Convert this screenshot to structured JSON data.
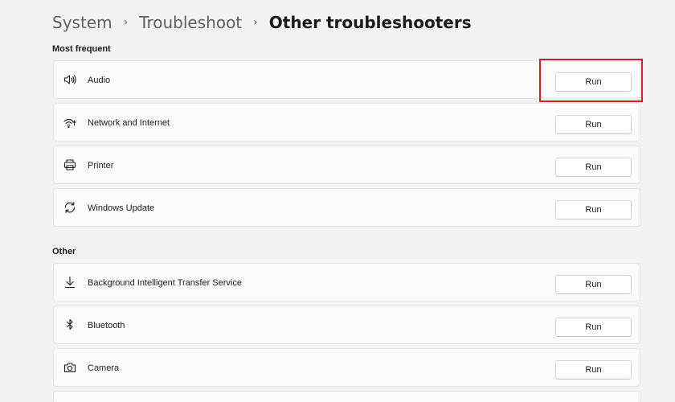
{
  "breadcrumb": {
    "items": [
      "System",
      "Troubleshoot",
      "Other troubleshooters"
    ],
    "separator": "›"
  },
  "sections": {
    "frequent": {
      "title": "Most frequent",
      "items": [
        {
          "label": "Audio",
          "icon": "speaker-icon",
          "button": "Run"
        },
        {
          "label": "Network and Internet",
          "icon": "wifi-icon",
          "button": "Run"
        },
        {
          "label": "Printer",
          "icon": "printer-icon",
          "button": "Run"
        },
        {
          "label": "Windows Update",
          "icon": "sync-icon",
          "button": "Run"
        }
      ]
    },
    "other": {
      "title": "Other",
      "items": [
        {
          "label": "Background Intelligent Transfer Service",
          "icon": "download-icon",
          "button": "Run"
        },
        {
          "label": "Bluetooth",
          "icon": "bluetooth-icon",
          "button": "Run"
        },
        {
          "label": "Camera",
          "icon": "camera-icon",
          "button": "Run"
        }
      ]
    }
  },
  "colors": {
    "background": "#f3f3f3",
    "card": "#fbfbfb",
    "highlight": "#d21f2b"
  }
}
